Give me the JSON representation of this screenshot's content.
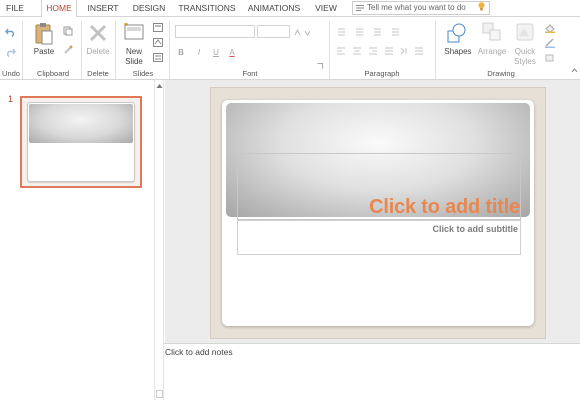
{
  "tabs": [
    {
      "label": "FILE"
    },
    {
      "label": "HOME"
    },
    {
      "label": "INSERT"
    },
    {
      "label": "DESIGN"
    },
    {
      "label": "TRANSITIONS"
    },
    {
      "label": "ANIMATIONS"
    },
    {
      "label": "VIEW"
    }
  ],
  "tell_me": {
    "placeholder": "Tell me what you want to do"
  },
  "ribbon": {
    "groups": {
      "undo": "Undo",
      "clipboard": "Clipboard",
      "delete": "Delete",
      "slides": "Slides",
      "font": "Font",
      "paragraph": "Paragraph",
      "drawing": "Drawing"
    },
    "buttons": {
      "paste": "Paste",
      "delete": "Delete",
      "new_slide_1": "New",
      "new_slide_2": "Slide",
      "shapes": "Shapes",
      "arrange": "Arrange",
      "quick_styles_1": "Quick",
      "quick_styles_2": "Styles"
    },
    "font_buttons": {
      "bold": "B",
      "italic": "I",
      "underline": "U",
      "color": "A"
    }
  },
  "slide_panel": {
    "number": "1"
  },
  "slide": {
    "title_placeholder": "Click to add title",
    "subtitle_placeholder": "Click to add subtitle"
  },
  "notes": {
    "placeholder": "Click to add notes"
  },
  "colors": {
    "accent": "#b7472a",
    "title": "#e8884f",
    "thumb_border": "#e0785a"
  }
}
